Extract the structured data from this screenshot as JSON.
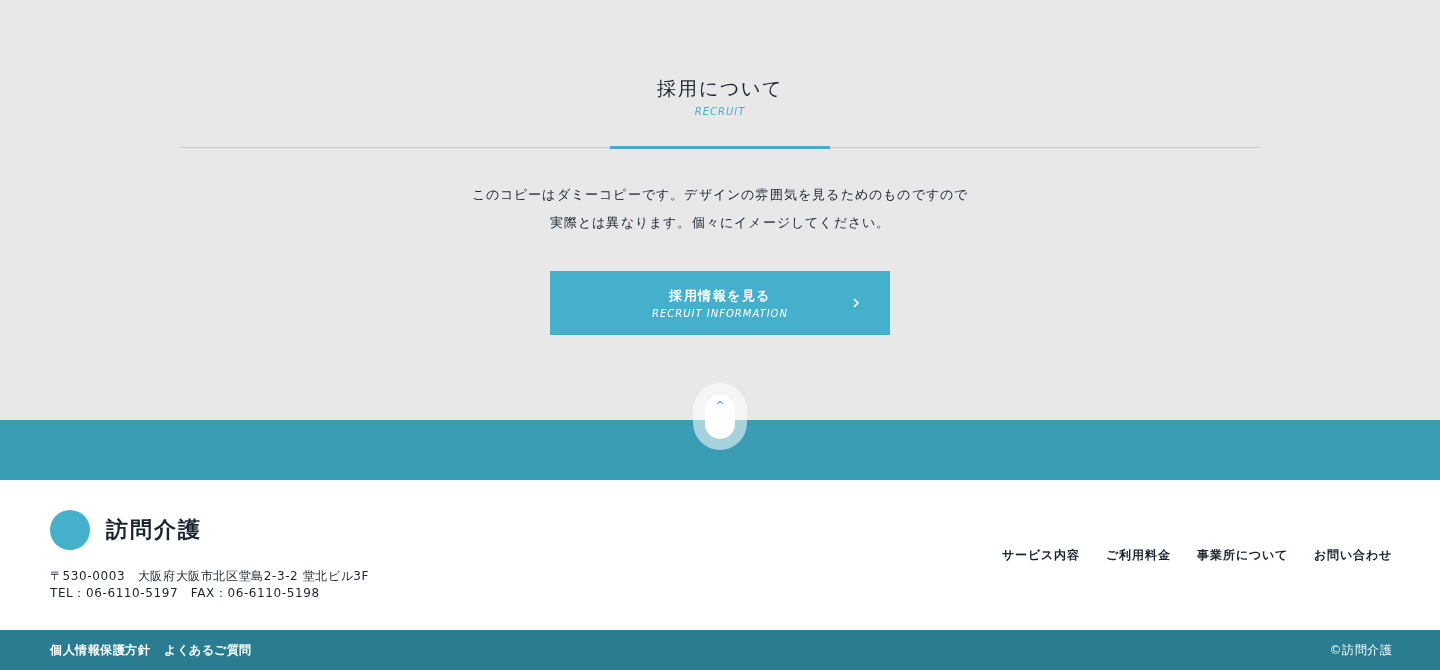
{
  "recruit": {
    "title": "採用について",
    "subtitle": "RECRUIT",
    "body": [
      "このコピーはダミーコピーです。デザインの雰囲気を見るためのものですので",
      "実際とは異なります。個々にイメージしてください。"
    ],
    "button": {
      "label": "採用情報を見る",
      "sublabel": "RECRUIT INFORMATION"
    }
  },
  "scroll_top": {
    "icon": "^"
  },
  "footer": {
    "logo": "訪問介護",
    "address": "〒530-0003　大阪府大阪市北区堂島2-3-2 堂北ビル3F",
    "contact": "TEL：06-6110-5197　FAX：06-6110-5198",
    "nav": [
      "サービス内容",
      "ご利用料金",
      "事業所について",
      "お問い合わせ"
    ]
  },
  "bottom_bar": {
    "links": [
      "個人情報保護方針",
      "よくあるご質問"
    ],
    "copyright": "©訪問介護"
  }
}
